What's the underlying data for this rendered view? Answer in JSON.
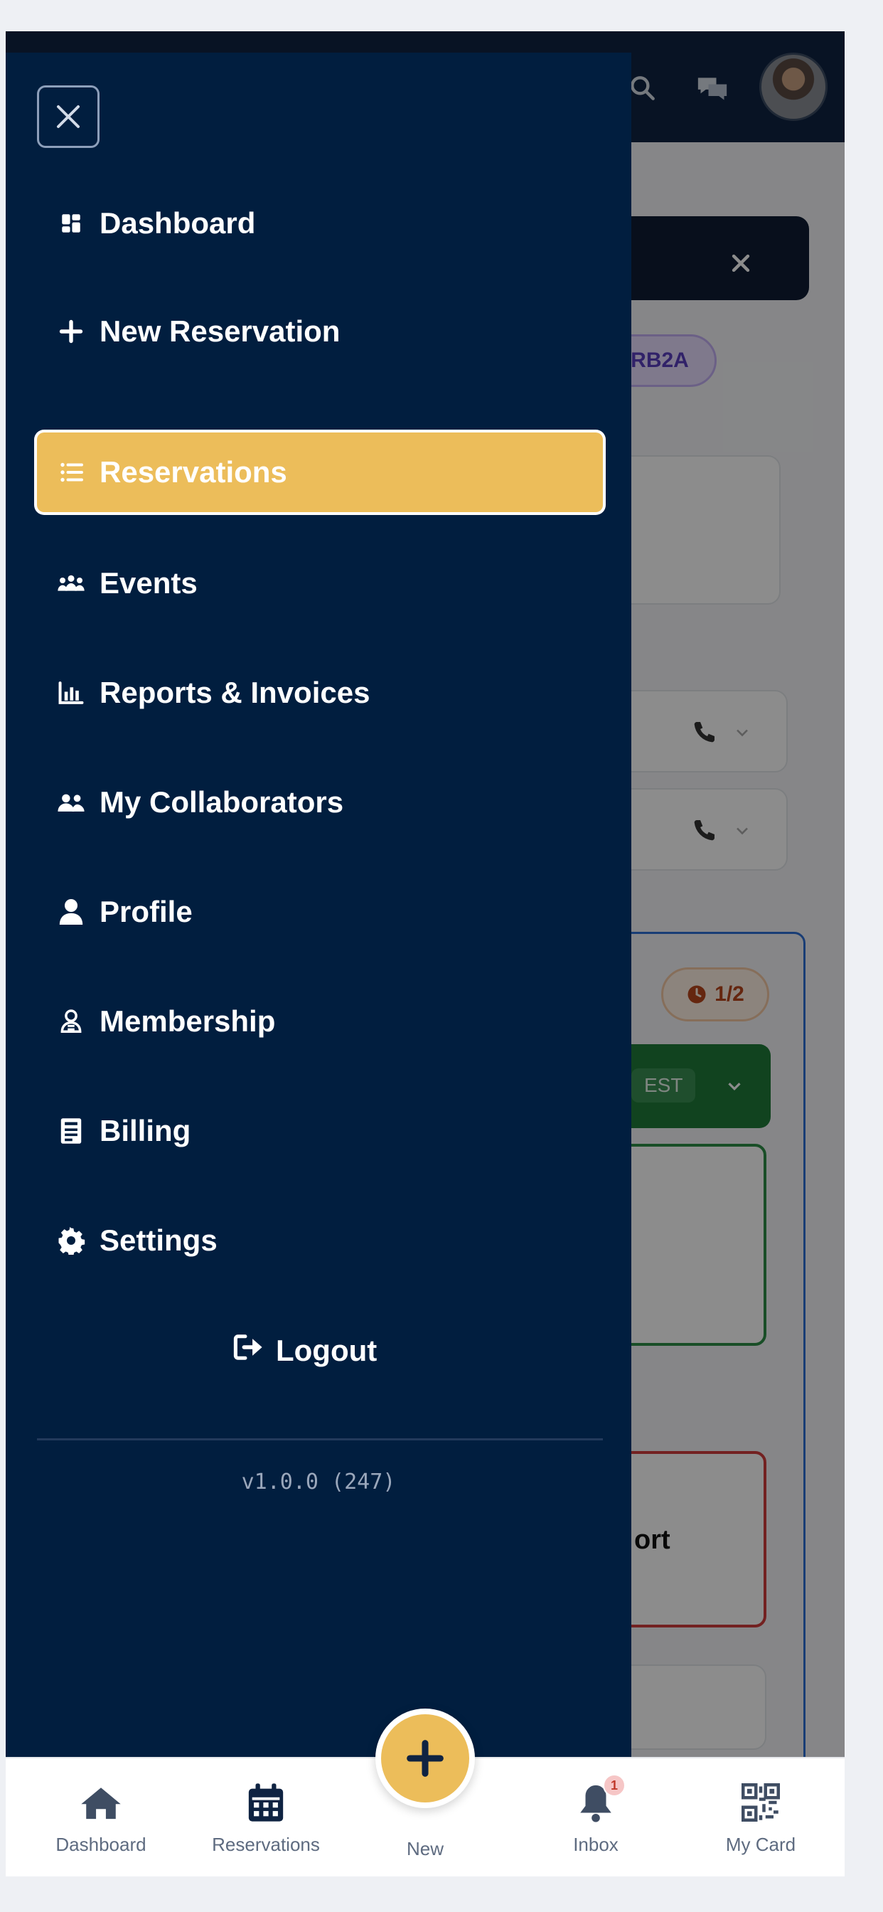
{
  "drawer": {
    "items": [
      {
        "label": "Dashboard",
        "icon": "dashboard-grid-icon"
      },
      {
        "label": "New Reservation",
        "icon": "plus-icon"
      },
      {
        "label": "Reservations",
        "icon": "list-icon",
        "active": true
      },
      {
        "label": "Events",
        "icon": "group-icon"
      },
      {
        "label": "Reports & Invoices",
        "icon": "chart-icon"
      },
      {
        "label": "My Collaborators",
        "icon": "users-icon"
      },
      {
        "label": "Profile",
        "icon": "user-icon"
      },
      {
        "label": "Membership",
        "icon": "membership-icon"
      },
      {
        "label": "Billing",
        "icon": "receipt-icon"
      },
      {
        "label": "Settings",
        "icon": "gear-icon"
      }
    ],
    "logout_label": "Logout",
    "version": "v1.0.0 (247)",
    "active_color": "#ecbd5a",
    "bg_color": "#011e3f"
  },
  "background": {
    "chip_text": "RB2A",
    "timer_text": "1/2",
    "green_tag": "EST",
    "red_card_text": "ort"
  },
  "tabbar": {
    "tabs": [
      {
        "label": "Dashboard",
        "icon": "home-icon"
      },
      {
        "label": "Reservations",
        "icon": "calendar-icon",
        "active": true
      },
      {
        "label": "New",
        "icon": "plus-icon"
      },
      {
        "label": "Inbox",
        "icon": "bell-icon",
        "badge": "1"
      },
      {
        "label": "My Card",
        "icon": "qr-icon"
      }
    ],
    "fab_color": "#ecbd5a"
  }
}
